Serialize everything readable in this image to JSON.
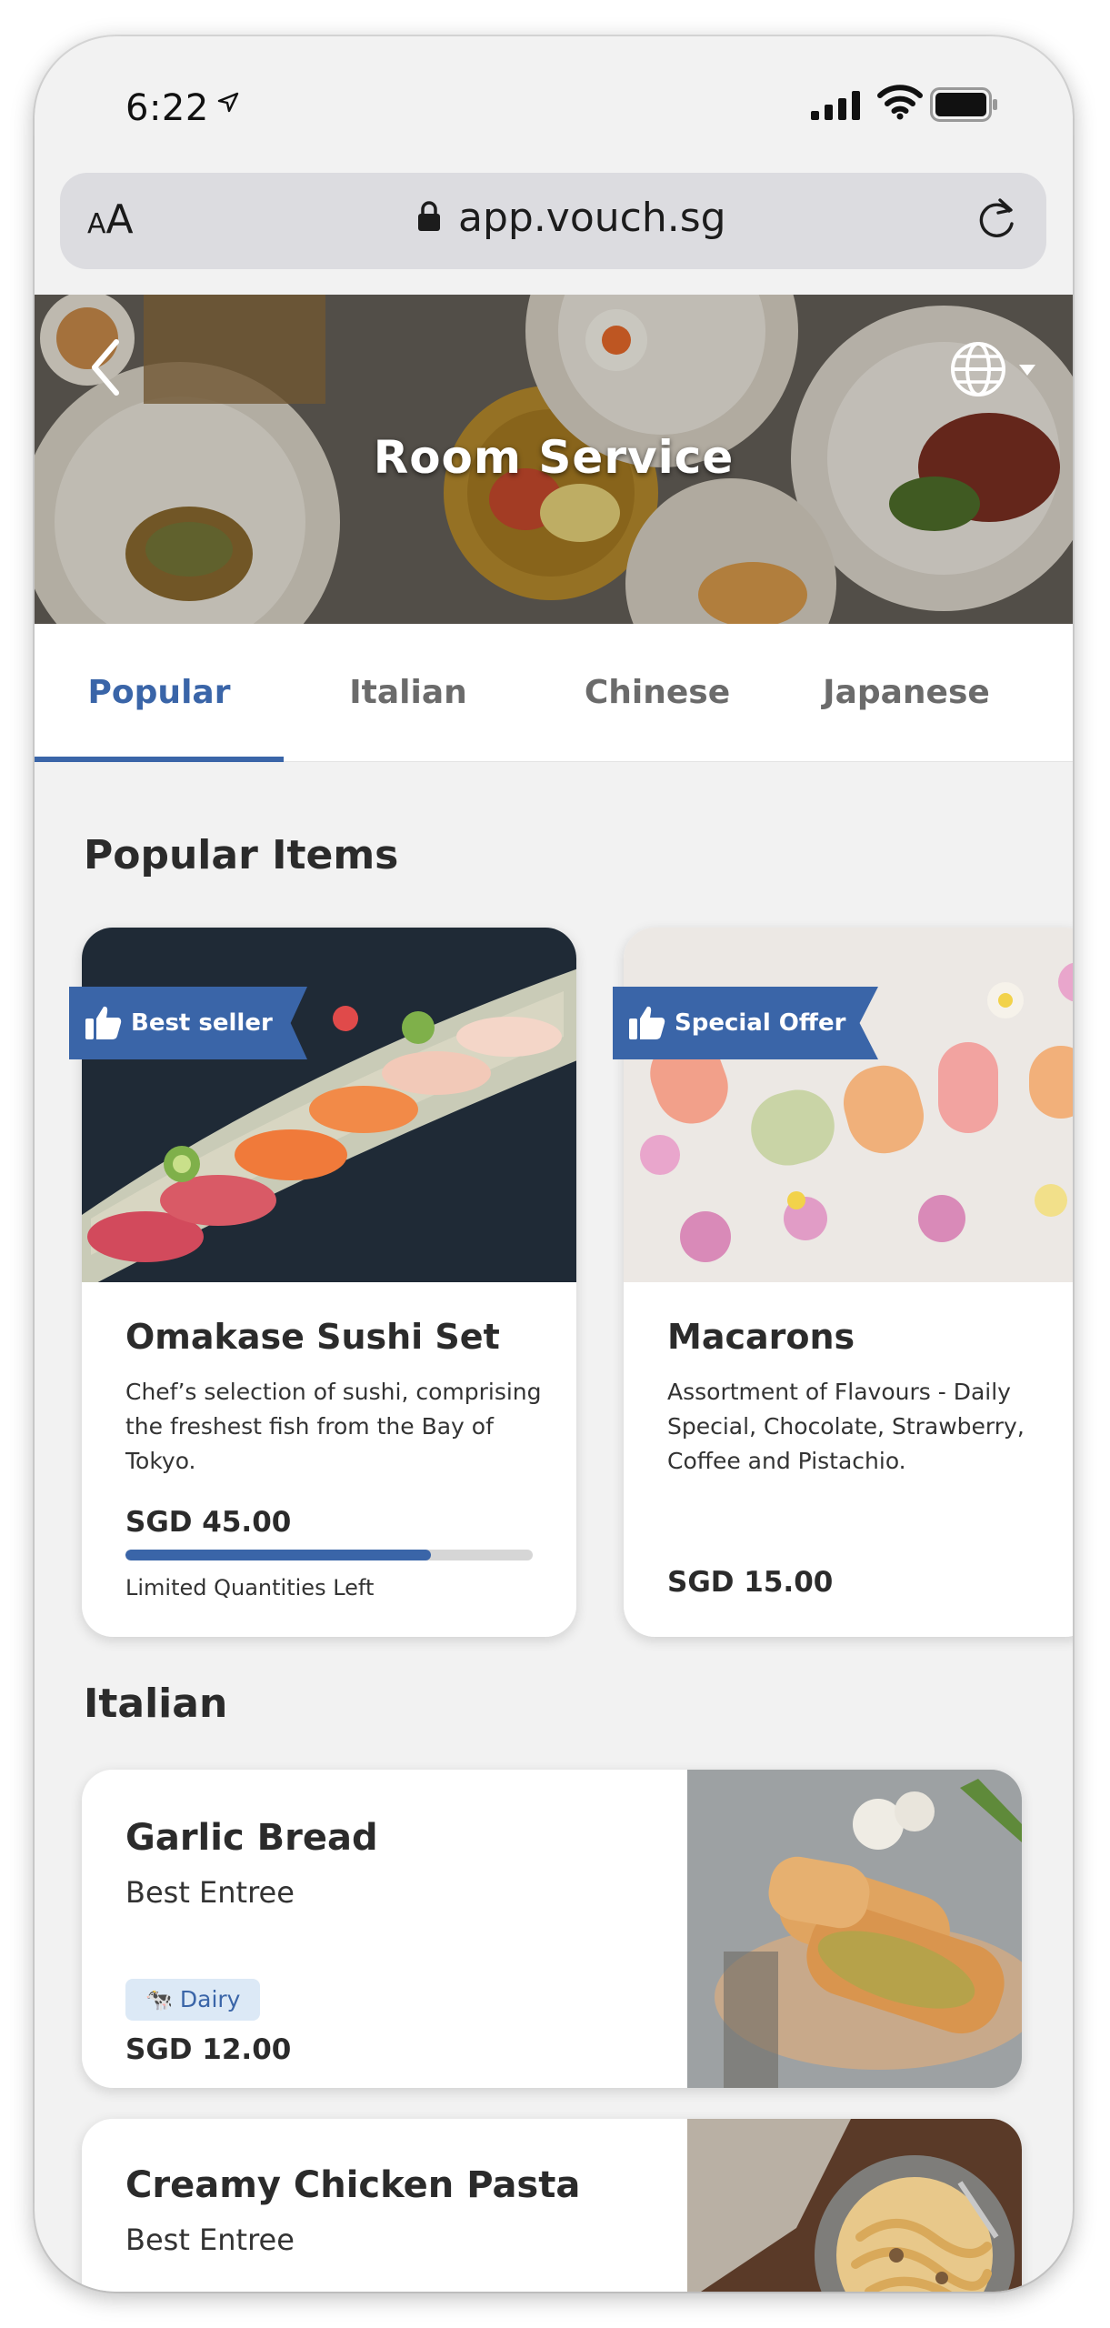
{
  "status": {
    "time": "6:22"
  },
  "browser": {
    "text_size_label_small": "A",
    "text_size_label_large": "A",
    "url": "app.vouch.sg"
  },
  "hero": {
    "title": "Room Service"
  },
  "tabs": [
    {
      "label": "Popular",
      "active": true
    },
    {
      "label": "Italian",
      "active": false
    },
    {
      "label": "Chinese",
      "active": false
    },
    {
      "label": "Japanese",
      "active": false
    }
  ],
  "popular": {
    "heading": "Popular Items",
    "items": [
      {
        "badge": "Best seller",
        "name": "Omakase Sushi Set",
        "description": "Chef’s selection of sushi, comprising the freshest fish from the Bay of Tokyo.",
        "price": "SGD 45.00",
        "stock_note": "Limited Quantities Left",
        "stock_fraction": 0.75
      },
      {
        "badge": "Special Offer",
        "name": "Macarons",
        "description": "Assortment of Flavours - Daily Special, Chocolate, Strawberry, Coffee and Pistachio.",
        "price": "SGD 15.00"
      }
    ]
  },
  "italian": {
    "heading": "Italian",
    "items": [
      {
        "name": "Garlic Bread",
        "subtitle": "Best Entree",
        "tag": "Dairy",
        "tag_icon": "cow-icon",
        "price": "SGD 12.00"
      },
      {
        "name": "Creamy Chicken Pasta",
        "subtitle": "Best Entree"
      }
    ]
  },
  "colors": {
    "accent": "#3a65a8",
    "tag_bg": "#dce9f6",
    "page_bg": "#f2f2f2"
  }
}
